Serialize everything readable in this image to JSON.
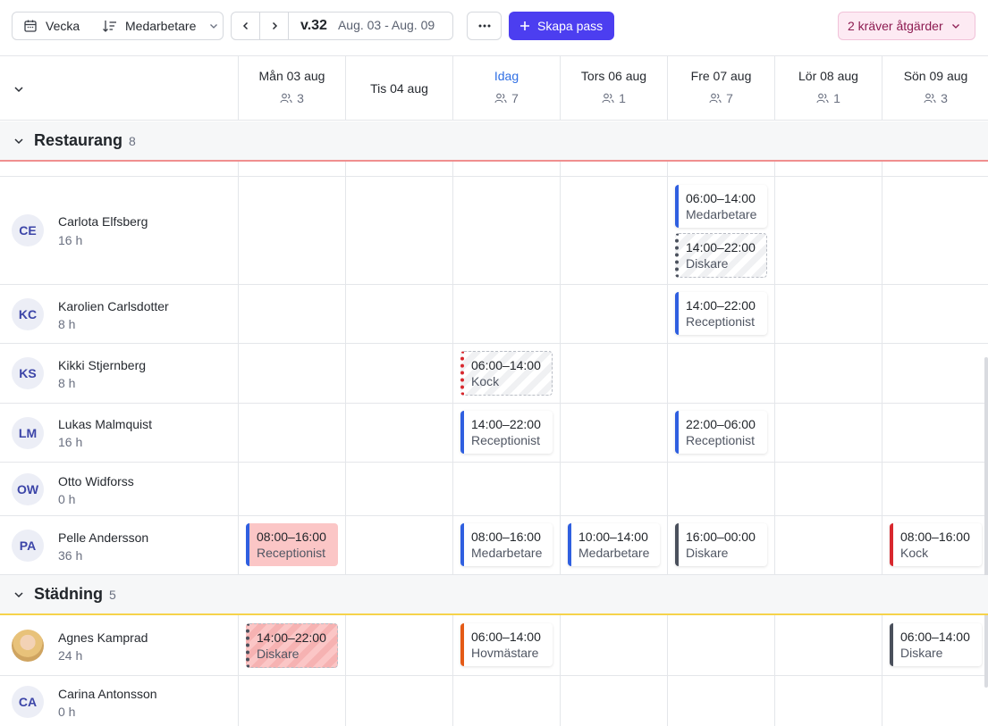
{
  "toolbar": {
    "view_label": "Vecka",
    "sort_label": "Medarbetare",
    "week_number": "v.32",
    "week_range": "Aug. 03 - Aug. 09",
    "create_label": "Skapa pass",
    "alert_label": "2 kräver åtgärder"
  },
  "days": [
    {
      "name": "Mån 03 aug",
      "count": "3"
    },
    {
      "name": "Tis 04 aug",
      "count": ""
    },
    {
      "name": "Idag",
      "count": "7"
    },
    {
      "name": "Tors 06 aug",
      "count": "1"
    },
    {
      "name": "Fre 07 aug",
      "count": "7"
    },
    {
      "name": "Lör 08 aug",
      "count": "1"
    },
    {
      "name": "Sön 09 aug",
      "count": "3"
    }
  ],
  "groups": [
    {
      "title": "Restaurang",
      "count": "8",
      "color": "#f08f8f"
    },
    {
      "title": "Städning",
      "count": "5",
      "color": "#f6d34a"
    }
  ],
  "people": [
    {
      "initials": "CE",
      "name": "Carlota Elfsberg",
      "hours": "16 h"
    },
    {
      "initials": "KC",
      "name": "Karolien Carlsdotter",
      "hours": "8 h"
    },
    {
      "initials": "KS",
      "name": "Kikki Stjernberg",
      "hours": "8 h"
    },
    {
      "initials": "LM",
      "name": "Lukas Malmquist",
      "hours": "16 h"
    },
    {
      "initials": "OW",
      "name": "Otto Widforss",
      "hours": "0 h"
    },
    {
      "initials": "PA",
      "name": "Pelle Andersson",
      "hours": "36 h"
    },
    {
      "initials": "",
      "name": "Agnes Kamprad",
      "hours": "24 h"
    },
    {
      "initials": "CA",
      "name": "Carina Antonsson",
      "hours": "0 h"
    }
  ],
  "shifts": {
    "ce_fre_1": {
      "time": "06:00–14:00",
      "role": "Medarbetare"
    },
    "ce_fre_2": {
      "time": "14:00–22:00",
      "role": "Diskare"
    },
    "kc_fre": {
      "time": "14:00–22:00",
      "role": "Receptionist"
    },
    "ks_ons": {
      "time": "06:00–14:00",
      "role": "Kock"
    },
    "lm_ons": {
      "time": "14:00–22:00",
      "role": "Receptionist"
    },
    "lm_fre": {
      "time": "22:00–06:00",
      "role": "Receptionist"
    },
    "pa_man": {
      "time": "08:00–16:00",
      "role": "Receptionist"
    },
    "pa_ons": {
      "time": "08:00–16:00",
      "role": "Medarbetare"
    },
    "pa_tors": {
      "time": "10:00–14:00",
      "role": "Medarbetare"
    },
    "pa_fre": {
      "time": "16:00–00:00",
      "role": "Diskare"
    },
    "pa_son": {
      "time": "08:00–16:00",
      "role": "Kock"
    },
    "ak_man": {
      "time": "14:00–22:00",
      "role": "Diskare"
    },
    "ak_ons": {
      "time": "06:00–14:00",
      "role": "Hovmästare"
    },
    "ak_son": {
      "time": "06:00–14:00",
      "role": "Diskare"
    }
  }
}
